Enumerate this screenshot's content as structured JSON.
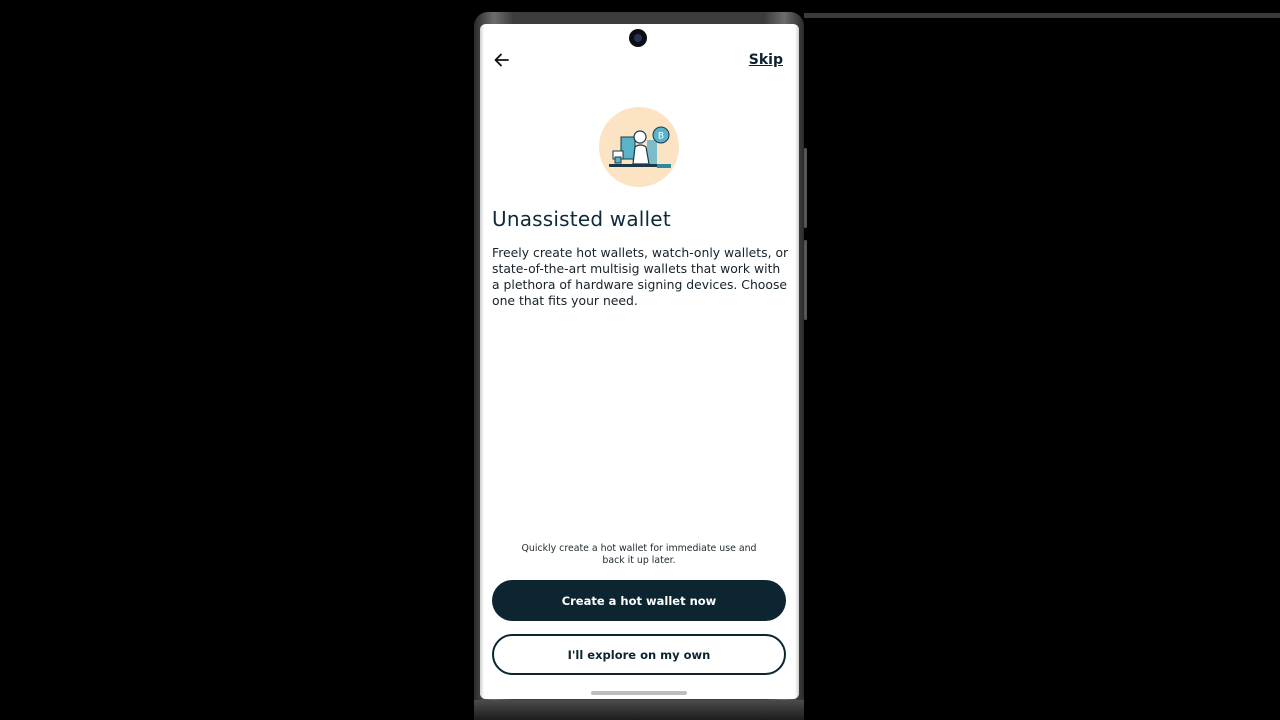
{
  "header": {
    "back_icon": "arrow-left-icon",
    "skip_label": "Skip"
  },
  "illustration": {
    "icon": "person-with-bitcoin-illustration",
    "bg_color": "#fbe3c4",
    "accent_color": "#5ab3c9"
  },
  "content": {
    "title": "Unassisted wallet",
    "description": "Freely create hot wallets, watch-only wallets, or state-of-the-art multisig wallets that work with a plethora of hardware signing devices. Choose one that fits your need."
  },
  "footer": {
    "hint": "Quickly create a hot wallet for immediate use and back it up later.",
    "primary_label": "Create a hot wallet now",
    "secondary_label": "I'll explore on my own"
  },
  "colors": {
    "primary": "#0c2530",
    "background": "#ffffff",
    "text": "#0f2a38"
  }
}
